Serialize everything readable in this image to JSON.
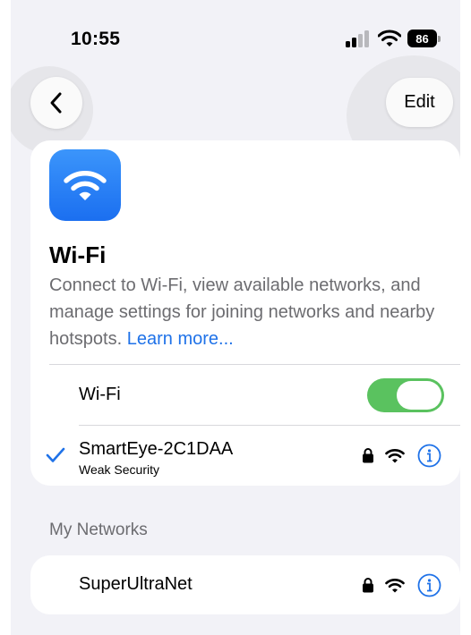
{
  "status_bar": {
    "time": "10:55",
    "battery": "86"
  },
  "nav": {
    "back_icon": "chevron-left-icon",
    "edit_label": "Edit"
  },
  "header": {
    "icon": "wifi-app-icon",
    "title": "Wi-Fi",
    "description": "Connect to Wi-Fi, view available networks, and manage settings for joining networks and nearby hotspots.",
    "learn_more": "Learn more..."
  },
  "wifi_toggle": {
    "label": "Wi-Fi",
    "on": true
  },
  "connected_network": {
    "name": "SmartEye-2C1DAA",
    "subtitle": "Weak Security",
    "icons": [
      "lock-icon",
      "wifi-signal-icon",
      "info-icon"
    ]
  },
  "my_networks": {
    "header": "My Networks",
    "items": [
      {
        "name": "SuperUltraNet",
        "icons": [
          "lock-icon",
          "wifi-signal-icon",
          "info-icon"
        ]
      }
    ]
  },
  "colors": {
    "accent": "#1f72e8",
    "toggle_on": "#5ac25f",
    "background": "#f2f2f7",
    "secondary_text": "#6c6c70"
  }
}
